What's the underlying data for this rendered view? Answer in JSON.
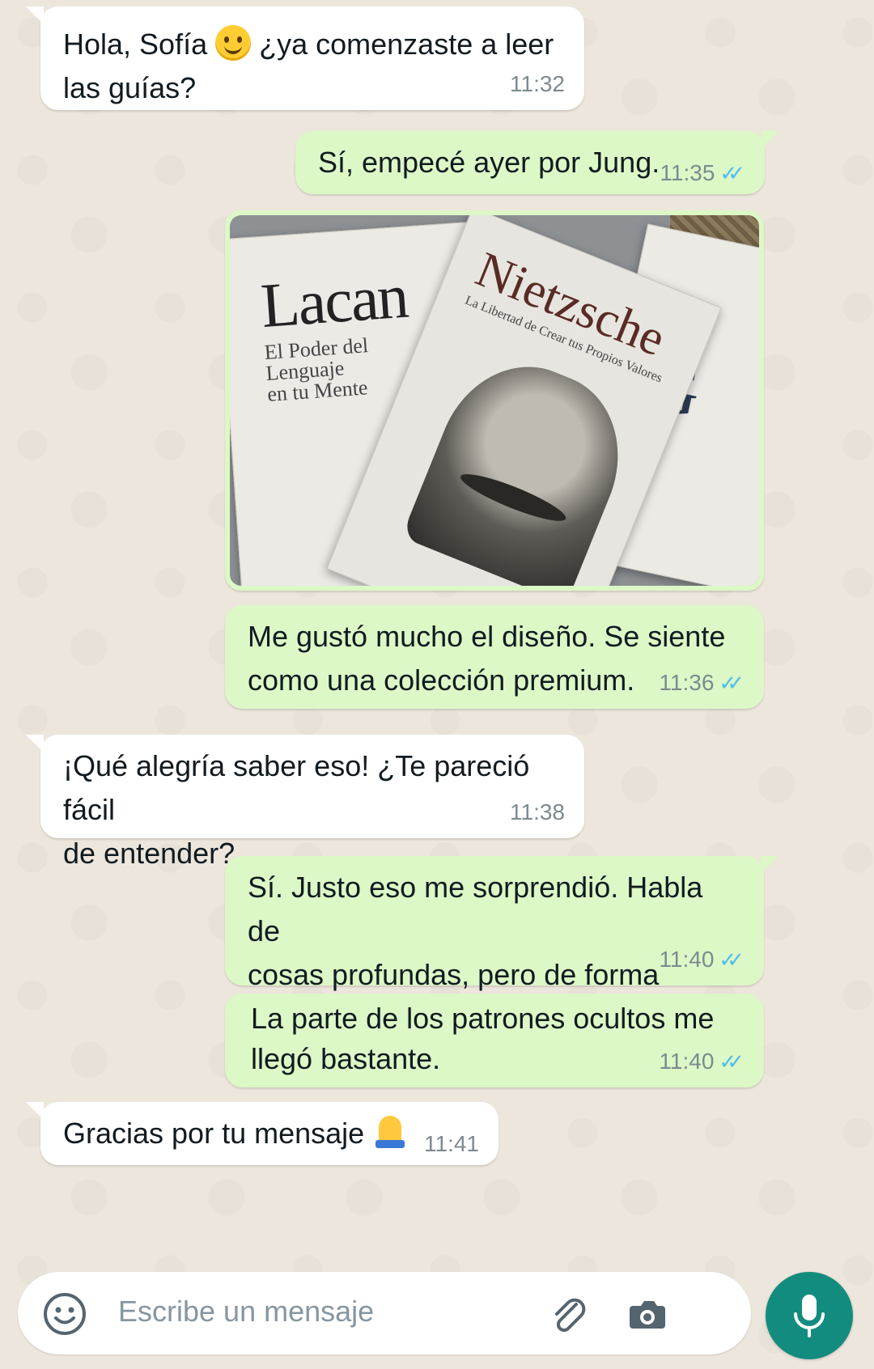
{
  "messages": [
    {
      "dir": "in",
      "text": "Hola, Sofía ",
      "text2": " ¿ya comenzaste a leer\nlas guías?",
      "emoji": "smiling-face",
      "time": "11:32"
    },
    {
      "dir": "out",
      "text": "Sí, empecé ayer por Jung.",
      "time": "11:35",
      "ticks": "✓✓"
    },
    {
      "dir": "out",
      "type": "image",
      "image_text": {
        "lacan_title": "Lacan",
        "lacan_sub": "El Poder del\nLenguaje\nen tu Mente",
        "nietzsche_title": "Nietzsche",
        "nietzsche_sub": "La Libertad de Crear tus Propios Valores",
        "jung_letter": "G"
      }
    },
    {
      "dir": "out",
      "text": "Me gustó mucho el diseño. Se siente\ncomo una colección premium.",
      "time": "11:36",
      "ticks": "✓✓"
    },
    {
      "dir": "in",
      "text": "¡Qué alegría saber eso! ¿Te pareció fácil\nde entender?",
      "time": "11:38"
    },
    {
      "dir": "out",
      "text": "Sí. Justo eso me sorprendió. Habla de\ncosas profundas, pero de forma simple.",
      "time": "11:40",
      "ticks": "✓✓"
    },
    {
      "dir": "out",
      "text": "La parte de los patrones ocultos me\nllegó bastante.",
      "time": "11:40",
      "ticks": "✓✓"
    },
    {
      "dir": "in",
      "text": "Gracias por tu mensaje ",
      "emoji": "folded-hands",
      "time": "11:41"
    }
  ],
  "composer": {
    "placeholder": "Escribe un mensaje",
    "icons": {
      "emoji": "emoji-icon",
      "attach": "paperclip-icon",
      "camera": "camera-icon",
      "mic": "microphone-icon"
    },
    "accent": "#128c7e"
  },
  "colors": {
    "incoming": "#ffffff",
    "outgoing": "#dcf8c6",
    "wallpaper": "#ede6dc",
    "read_ticks": "#53bdeb"
  }
}
